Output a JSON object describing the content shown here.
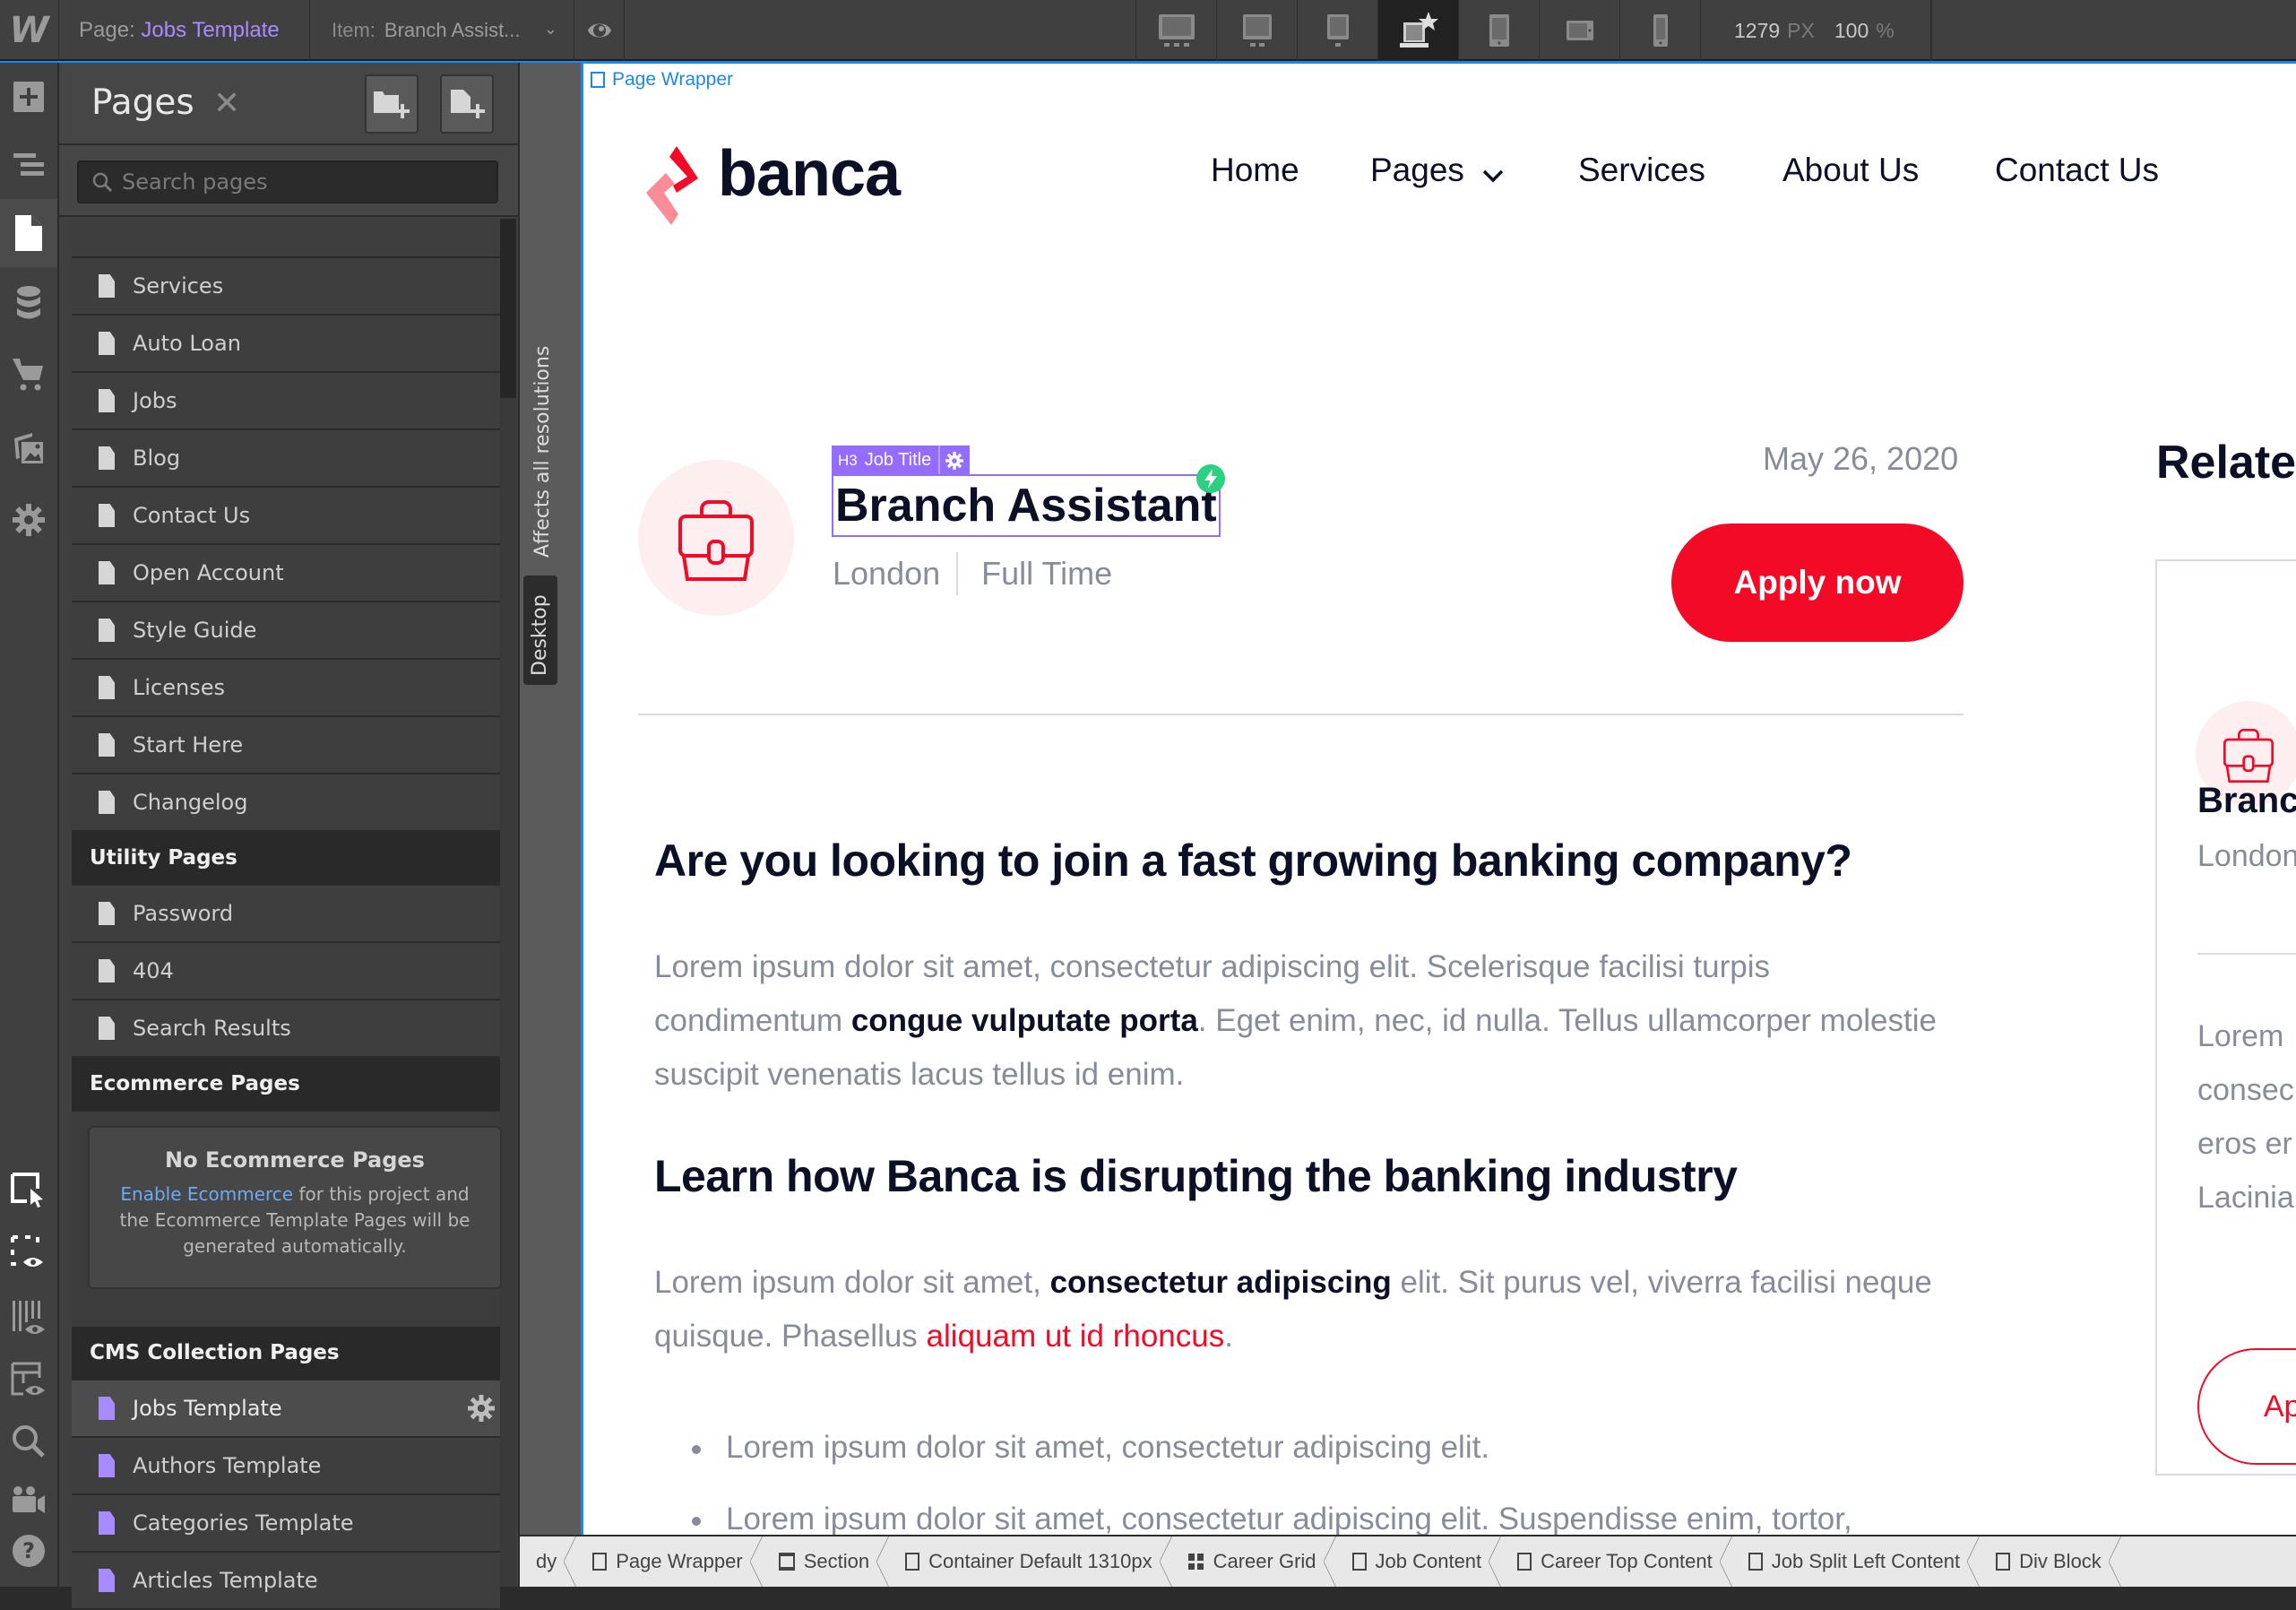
{
  "topbar": {
    "logo": "W",
    "page_label": "Page:",
    "page_value": "Jobs Template",
    "item_label": "Item:",
    "item_value": "Branch Assist...",
    "devices": [
      {
        "name": "desktop-xxl",
        "active": false
      },
      {
        "name": "desktop-xl",
        "active": false
      },
      {
        "name": "desktop-l",
        "active": false
      },
      {
        "name": "desktop-base",
        "active": true
      },
      {
        "name": "tablet",
        "active": false
      },
      {
        "name": "mobile-landscape",
        "active": false
      },
      {
        "name": "mobile-portrait",
        "active": false
      }
    ],
    "width_value": "1279",
    "width_unit": "PX",
    "zoom_value": "100",
    "zoom_unit": "%"
  },
  "rail": {
    "top_icons": [
      "add-icon",
      "navigator-icon",
      "pages-icon",
      "cms-icon",
      "ecommerce-icon",
      "assets-icon",
      "settings-icon"
    ],
    "bottom_icons": [
      "select-mode-icon",
      "preview-outline-icon",
      "xray-icon",
      "audit-icon",
      "search-icon",
      "video-tutorials-icon",
      "help-icon"
    ]
  },
  "pages_panel": {
    "title": "Pages",
    "search_placeholder": "Search pages",
    "static_pages": [
      "Services",
      "Auto Loan",
      "Jobs",
      "Blog",
      "Contact Us",
      "Open Account",
      "Style Guide",
      "Licenses",
      "Start Here",
      "Changelog"
    ],
    "utility_heading": "Utility Pages",
    "utility_pages": [
      "Password",
      "404",
      "Search Results"
    ],
    "ecommerce_heading": "Ecommerce Pages",
    "ecommerce_empty_title": "No Ecommerce Pages",
    "ecommerce_link": "Enable Ecommerce",
    "ecommerce_text": " for this project and the Ecommerce Template Pages will be generated automatically.",
    "cms_heading": "CMS Collection Pages",
    "cms_pages": [
      "Jobs Template",
      "Authors Template",
      "Categories Template",
      "Articles Template"
    ],
    "selected_cms_page": "Jobs Template"
  },
  "vstrip": {
    "affects": "Affects all resolutions",
    "breakpoint": "Desktop"
  },
  "canvas": {
    "element_label": "Page Wrapper",
    "site": {
      "brand": "banca",
      "nav": [
        "Home",
        "Pages",
        "Services",
        "About Us",
        "Contact Us"
      ],
      "selection_tag_type": "H3",
      "selection_tag_name": "Job Title",
      "job_title": "Branch Assistant",
      "location": "London",
      "job_type": "Full Time",
      "date": "May 26, 2020",
      "apply_label": "Apply now",
      "heading1": "Are you looking to join a fast growing banking company?",
      "para1_a": "Lorem ipsum dolor sit amet, consectetur adipiscing elit. Scelerisque facilisi turpis condimentum ",
      "para1_bold": "congue vulputate porta",
      "para1_b": ". Eget enim, nec, id nulla. Tellus ullamcorper molestie suscipit venenatis lacus tellus id enim.",
      "heading2": "Learn how Banca is disrupting the banking industry",
      "para2_a": "Lorem ipsum dolor sit amet, ",
      "para2_bold": "consectetur adipiscing",
      "para2_b": " elit. Sit purus vel, viverra facilisi neque quisque. Phasellus ",
      "para2_link": "aliquam ut id rhoncus",
      "para2_c": ".",
      "bullets": [
        "Lorem ipsum dolor sit amet, consectetur adipiscing elit.",
        "Lorem ipsum dolor sit amet, consectetur adipiscing elit. Suspendisse enim, tortor,"
      ],
      "related_heading": "Relate",
      "related_card": {
        "title": "Branc",
        "location": "London",
        "text_lines": [
          "Lorem",
          "consec",
          "eros er",
          "Lacinia"
        ],
        "button": "Ap"
      }
    },
    "colors": {
      "accent": "#f20a26",
      "heading": "#0b1026",
      "body": "#868c9a",
      "selection": "#946cff",
      "designer_blue": "#1e88e5"
    }
  },
  "breadcrumbs": [
    {
      "label": "dy",
      "icon": "none"
    },
    {
      "label": "Page Wrapper",
      "icon": "box"
    },
    {
      "label": "Section",
      "icon": "section"
    },
    {
      "label": "Container Default 1310px",
      "icon": "box"
    },
    {
      "label": "Career Grid",
      "icon": "grid"
    },
    {
      "label": "Job Content",
      "icon": "box"
    },
    {
      "label": "Career Top Content",
      "icon": "box"
    },
    {
      "label": "Job Split Left Content",
      "icon": "box"
    },
    {
      "label": "Div Block",
      "icon": "box"
    }
  ]
}
